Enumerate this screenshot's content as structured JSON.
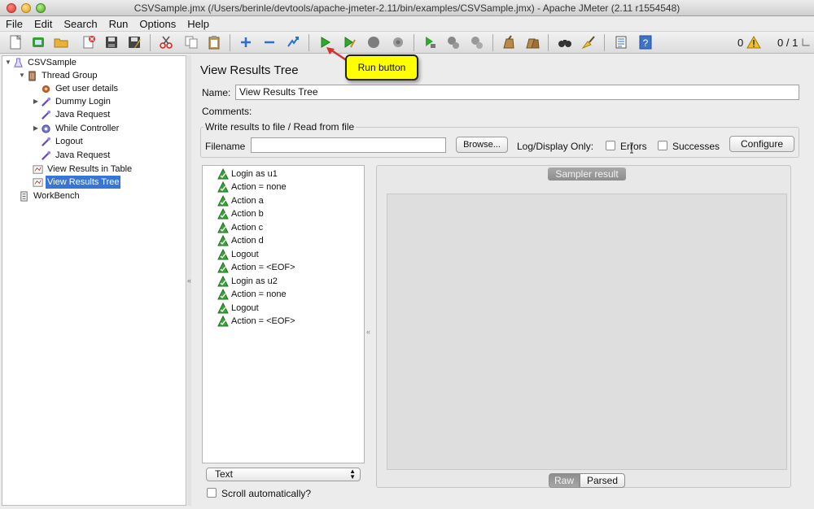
{
  "window": {
    "title": "CSVSample.jmx (/Users/berinle/devtools/apache-jmeter-2.11/bin/examples/CSVSample.jmx) - Apache JMeter (2.11 r1554548)"
  },
  "menu": [
    "File",
    "Edit",
    "Search",
    "Run",
    "Options",
    "Help"
  ],
  "toolbar": {
    "warnings": "0",
    "threads": "0 / 1"
  },
  "callout": {
    "text": "Run button"
  },
  "tree": [
    {
      "label": "CSVSample",
      "icon": "flask-icon"
    },
    {
      "label": "Thread Group",
      "icon": "thread-group-icon"
    },
    {
      "label": "Get user details",
      "icon": "csv-config-icon"
    },
    {
      "label": "Dummy Login",
      "icon": "sampler-icon"
    },
    {
      "label": "Java Request",
      "icon": "sampler-icon"
    },
    {
      "label": "While Controller",
      "icon": "controller-icon"
    },
    {
      "label": "Logout",
      "icon": "sampler-icon"
    },
    {
      "label": "Java Request",
      "icon": "sampler-icon"
    },
    {
      "label": "View Results in Table",
      "icon": "listener-icon"
    },
    {
      "label": "View Results Tree",
      "icon": "listener-icon"
    },
    {
      "label": "WorkBench",
      "icon": "workbench-icon"
    }
  ],
  "panel": {
    "title": "View Results Tree",
    "name_label": "Name:",
    "name_value": "View Results Tree",
    "comments_label": "Comments:",
    "file_group_legend": "Write results to file / Read from file",
    "filename_label": "Filename",
    "browse_button": "Browse...",
    "log_display_label": "Log/Display Only:",
    "errors_label": "Errors",
    "successes_label": "Successes",
    "configure_button": "Configure"
  },
  "results": [
    "Login as u1",
    "Action = none",
    "Action a",
    "Action b",
    "Action c",
    "Action d",
    "Logout",
    "Action = <EOF>",
    "Login as u2",
    "Action = none",
    "Logout",
    "Action = <EOF>"
  ],
  "renderer": {
    "selected": "Text",
    "scroll_label": "Scroll automatically?"
  },
  "sampler": {
    "tab_label": "Sampler result",
    "raw_tab": "Raw",
    "parsed_tab": "Parsed"
  },
  "colors": {
    "selection": "#3875d7",
    "callout": "#ffff00",
    "success": "#3aa63a"
  }
}
